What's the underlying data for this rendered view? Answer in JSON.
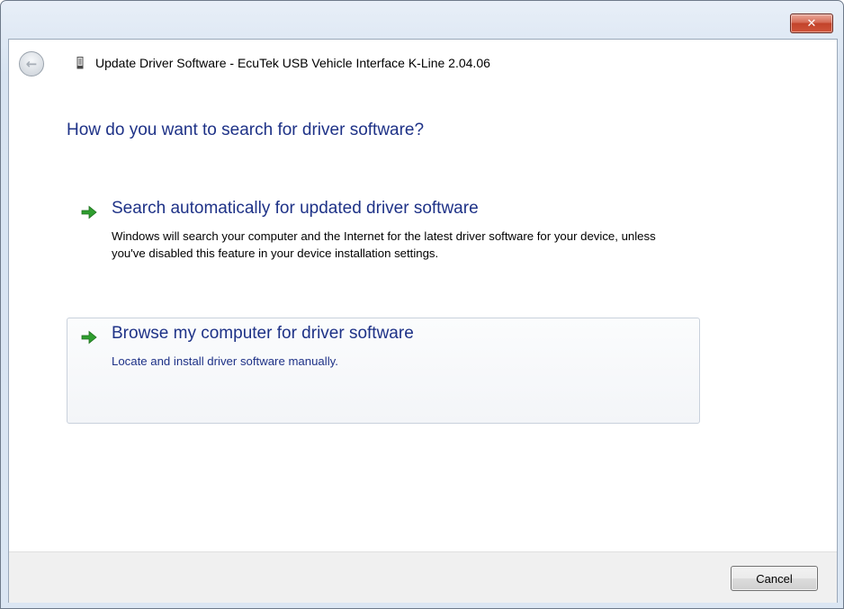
{
  "window": {
    "close_glyph": "✕",
    "title": "Update Driver Software - EcuTek USB Vehicle Interface K-Line 2.04.06",
    "back_glyph": "←"
  },
  "main": {
    "question": "How do you want to search for driver software?",
    "options": [
      {
        "title": "Search automatically for updated driver software",
        "description": "Windows will search your computer and the Internet for the latest driver software for your device, unless you've disabled this feature in your device installation settings.",
        "icon": "green-arrow-icon"
      },
      {
        "title": "Browse my computer for driver software",
        "description": "Locate and install driver software manually.",
        "icon": "green-arrow-icon"
      }
    ]
  },
  "footer": {
    "cancel_label": "Cancel"
  },
  "colors": {
    "heading_blue": "#1e3287",
    "arrow_green": "#2f9e2f",
    "close_red": "#c2432b"
  }
}
